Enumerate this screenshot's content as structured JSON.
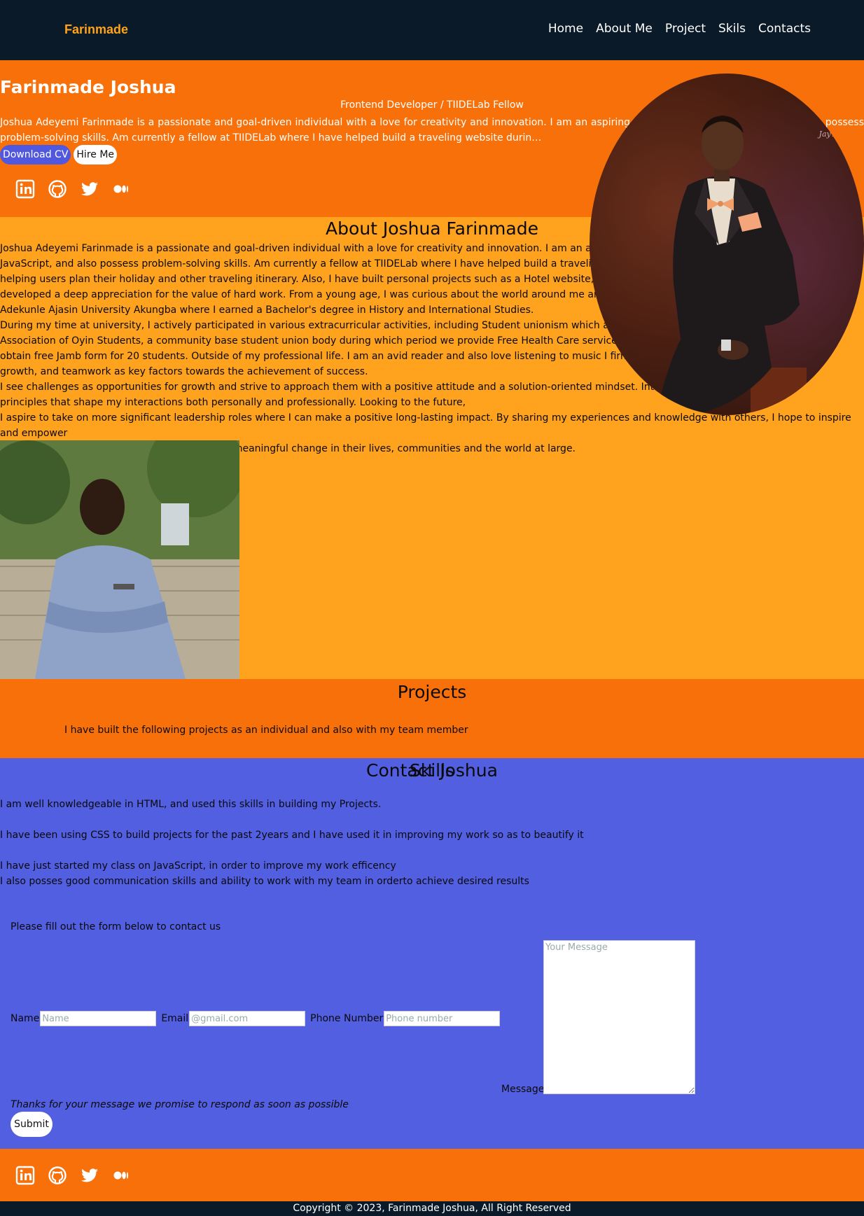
{
  "nav": {
    "brand": "Farinmade",
    "links": [
      "Home",
      "About Me",
      "Project",
      "Skils",
      "Contacts"
    ]
  },
  "hero": {
    "name": "Farinmade Joshua",
    "role": "Frontend Developer / TIIDELab Fellow",
    "bio": "Joshua Adeyemi Farinmade is a passionate and goal-driven individual with a love for creativity and innovation. I am an aspiring soft… HTML, CSS, JavaScript, and also possess problem-solving skills. Am currently a fellow at TIIDELab where I have helped build a traveling website durin…",
    "download_cv": "Download CV",
    "hire_me": "Hire Me",
    "signature": "JayTech S"
  },
  "socials": [
    "linkedin-icon",
    "github-icon",
    "twitter-icon",
    "medium-icon"
  ],
  "about": {
    "title": "About Joshua Farinmade",
    "paragraphs": [
      "Joshua Adeyemi Farinmade is a passionate and goal-driven individual with a love for creativity and innovation. I am an aspiring soft",
      "JavaScript, and also possess problem-solving skills. Am currently a fellow at TIIDELab where I have helped build a traveling website",
      "helping users plan their holiday and other traveling itinerary. Also, I have built personal projects such as a Hotel website, A financial",
      "developed a deep appreciation for the value of hard work. From a young age, I was curious about the world around me and consta",
      "Adekunle Ajasin University Akungba where I earned a Bachelor's degree in History and International Studies.",
      "During my time at university, I actively participated in various extracurricular activities, including Student unionism which afford me th",
      "Association of Oyin Students, a community base student union body during which period we provide Free Health Care service to the a",
      "obtain free Jamb form for 20 students. Outside of my professional life. I am an avid reader and also love listening to music I firmly believ",
      "growth, and teamwork as key factors towards the achievement of success.",
      "I see challenges as opportunities for growth and strive to approach them with a positive attitude and a solution-oriented mindset. Integrity, ho",
      "principles that shape my interactions both personally and professionally. Looking to the future,",
      "I aspire to take on more significant leadership roles where I can make a positive long-lasting impact. By sharing my experiences and knowledge with others, I hope to inspire and empower",
      "individuals to pursue their passions and create meaningful change in their lives, communities and the world at large."
    ]
  },
  "projects": {
    "title": "Projects",
    "text": "I have built the following projects as an individual and also with my team member"
  },
  "skills": {
    "title": "Skills",
    "lines": [
      "I am well knowledgeable in HTML, and used this skills in building my Projects.",
      "I have been using CSS to build projects for the past 2years and I have used it in improving my work so as to beautify it",
      "I have just started my class on JavaScript, in order to improve my work efficency",
      "I also posses good communication skills and ability to work with my team in orderto achieve desired results"
    ]
  },
  "contact": {
    "title": "Contact Joshua",
    "intro": "Please fill out the form below to contact us",
    "name_label": "Name",
    "name_placeholder": "Name",
    "email_label": "Email",
    "email_placeholder": "@gmail.com",
    "phone_label": "Phone Number",
    "phone_placeholder": "Phone number",
    "message_label": "Message",
    "message_placeholder": "Your Message",
    "thanks": "Thanks for your message we promise to respond as soon as possible",
    "submit": "Submit"
  },
  "footer": {
    "copyright": "Copyright © 2023, Farinmade Joshua, All Right Reserved"
  },
  "colors": {
    "nav_bg": "#0b1a28",
    "brand": "#ffa31a",
    "hero_bg": "#f8700a",
    "about_bg": "#ffa21d",
    "skills_bg": "#525fe1",
    "cv_button": "#5058e0"
  }
}
